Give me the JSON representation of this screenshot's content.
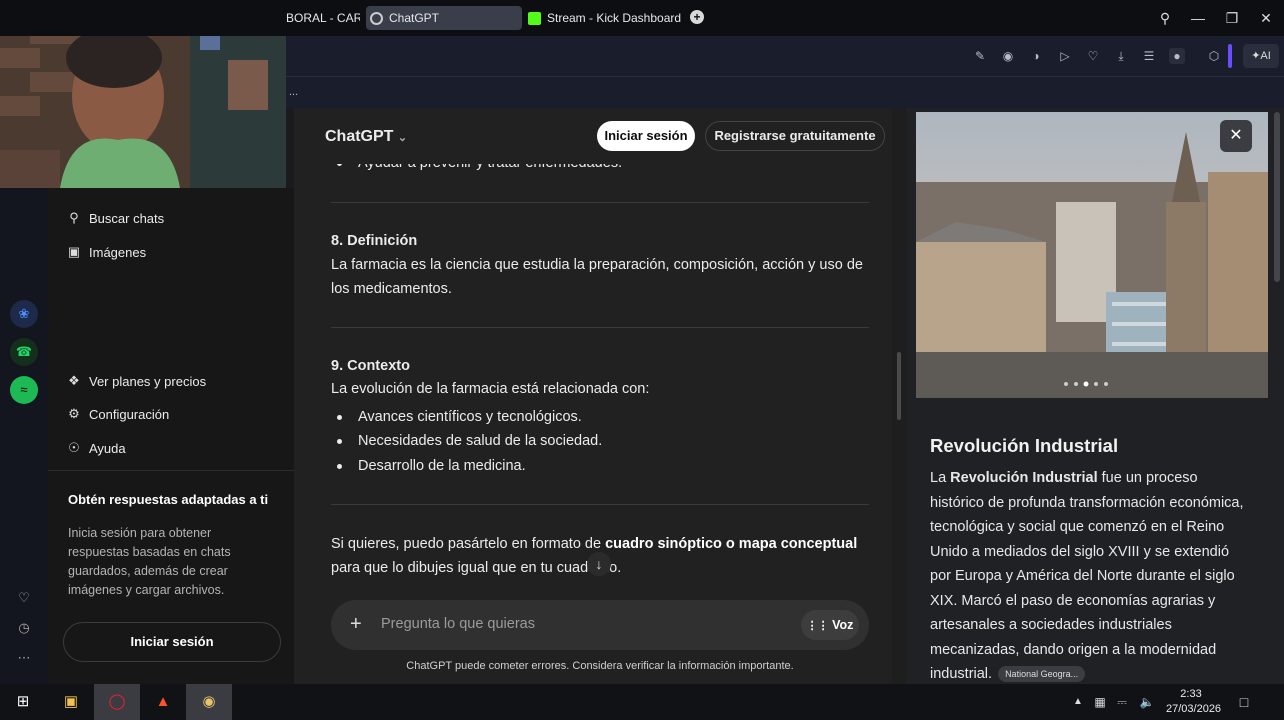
{
  "browser": {
    "tabs": [
      {
        "label": "BORAL - CARG"
      },
      {
        "label": "ChatGPT"
      },
      {
        "label": "Stream - Kick Dashboard"
      }
    ],
    "new_tab": "+",
    "ai_button": "AI",
    "bookmarks_more": "..."
  },
  "gpt_sidebar": {
    "items": [
      {
        "label": "Buscar chats",
        "icon": "search-icon"
      },
      {
        "label": "Imágenes",
        "icon": "images-icon"
      },
      {
        "label": "Ver planes y precios",
        "icon": "plans-icon"
      },
      {
        "label": "Configuración",
        "icon": "gear-icon"
      },
      {
        "label": "Ayuda",
        "icon": "help-icon"
      }
    ],
    "promo_title": "Obtén respuestas adaptadas a ti",
    "promo_text": "Inicia sesión para obtener respuestas basadas en chats guardados, además de crear imágenes y cargar archivos.",
    "login_label": "Iniciar sesión"
  },
  "chat": {
    "model": "ChatGPT",
    "login_label": "Iniciar sesión",
    "signup_label": "Registrarse gratuitamente",
    "bullet_top": "Ayudar a prevenir y tratar enfermedades.",
    "section8_title": "8. Definición",
    "section8_text": "La farmacia es la ciencia que estudia la preparación, composición, acción y uso de los medicamentos.",
    "section9_title": "9. Contexto",
    "section9_intro": "La evolución de la farmacia está relacionada con:",
    "section9_bullets": [
      "Avances científicos y tecnológicos.",
      "Necesidades de salud de la sociedad.",
      "Desarrollo de la medicina."
    ],
    "closing_a": "Si quieres, puedo pasártelo en formato de ",
    "closing_bold": "cuadro sinóptico o mapa conceptual",
    "closing_b": " para que lo dibujes igual que en tu cuaderno.",
    "composer_placeholder": "Pregunta lo que quieras",
    "voice_label": "Voz",
    "disclaimer": "ChatGPT puede cometer errores. Considera verificar la información importante."
  },
  "knowledge_panel": {
    "title": "Revolución Industrial",
    "text_lead": "La ",
    "text_bold": "Revolución Industrial",
    "text_rest": " fue un proceso histórico de profunda transformación económica, tecnológica y social que comenzó en el Reino Unido a mediados del siglo XVIII y se extendió por Europa y América del Norte durante el siglo XIX. Marcó el paso de economías agrarias y artesanales a sociedades industriales mecanizadas, dando origen a la modernidad industrial.",
    "source": "National Geogra..."
  },
  "taskbar": {
    "time": "2:33",
    "date": "27/03/2026"
  },
  "colors": {
    "chat_bg": "#212121",
    "sidebar_bg": "#171717",
    "panel_bg": "#202124",
    "toolbar_bg": "#1a1d2c"
  }
}
